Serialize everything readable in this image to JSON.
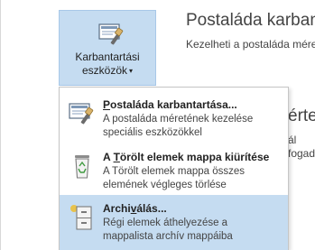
{
  "ribbon": {
    "tool_button": {
      "line1": "Karbantartási",
      "line2": "eszközök",
      "icon": "mailbox-tools-icon"
    }
  },
  "pane": {
    "title": "Postaláda karban",
    "description": "Kezelheti a postaláda méret",
    "second_title": "érte",
    "second_desc_line1": "ál",
    "second_desc_line2": "fogad"
  },
  "menu": {
    "items": [
      {
        "title_underlined": "P",
        "title_rest": "ostaláda karbantartása...",
        "desc_line1": "A postaláda méretének kezelése",
        "desc_line2": "speciális eszközökkel",
        "icon": "mailbox-cleanup-icon",
        "selected": false
      },
      {
        "title_prefix": "A ",
        "title_underlined": "T",
        "title_rest": "örölt elemek mappa kiürítése",
        "desc_line1": "A Törölt elemek mappa összes",
        "desc_line2": "elemének végleges törlése",
        "icon": "recycle-bin-icon",
        "selected": false
      },
      {
        "title_prefix": "Archi",
        "title_underlined": "v",
        "title_rest": "álás...",
        "desc_line1": "Régi elemek áthelyezése a",
        "desc_line2": "mappalista archív mappáiba",
        "icon": "archive-cabinet-icon",
        "selected": true
      }
    ]
  },
  "colors": {
    "selection": "#c5dcf1",
    "text": "#222222",
    "muted_text": "#444444"
  }
}
